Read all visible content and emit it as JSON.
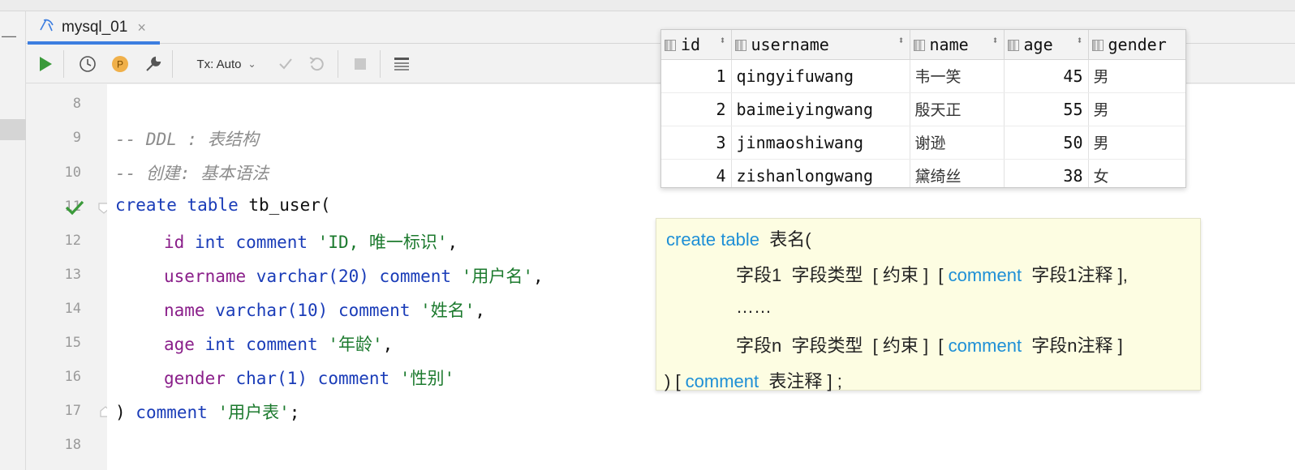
{
  "tab": {
    "label": "mysql_01",
    "close": "×"
  },
  "toolbar": {
    "tx_mode": "Tx: Auto",
    "p_badge": "P"
  },
  "editor": {
    "line_numbers": [
      "8",
      "9",
      "10",
      "11",
      "12",
      "13",
      "14",
      "15",
      "16",
      "17",
      "18"
    ],
    "lines": {
      "l9": "-- DDL : 表结构",
      "l10": "-- 创建: 基本语法",
      "l11_kw": "create table",
      "l11_rest": " tb_user(",
      "l12_a": "id",
      "l12_b": " int ",
      "l12_c": "comment",
      "l12_d": " 'ID, 唯一标识'",
      "l12_e": ",",
      "l13_a": "username",
      "l13_b": " varchar(",
      "l13_n": "20",
      "l13_c": ") ",
      "l13_d": "comment",
      "l13_e": " '用户名'",
      "l13_f": ",",
      "l14_a": "name",
      "l14_b": " varchar(",
      "l14_n": "10",
      "l14_c": ") ",
      "l14_d": "comment",
      "l14_e": " '姓名'",
      "l14_f": ",",
      "l15_a": "age",
      "l15_b": " int ",
      "l15_c": "comment",
      "l15_d": " '年龄'",
      "l15_e": ",",
      "l16_a": "gender",
      "l16_b": " char(",
      "l16_n": "1",
      "l16_c": ") ",
      "l16_d": "comment",
      "l16_e": " '性别'",
      "l17_a": ") ",
      "l17_b": "comment",
      "l17_c": " '用户表'",
      "l17_d": ";"
    }
  },
  "result_grid": {
    "columns": [
      "id",
      "username",
      "name",
      "age",
      "gender"
    ],
    "rows": [
      {
        "id": "1",
        "username": "qingyifuwang",
        "name": "韦一笑",
        "age": "45",
        "gender": "男"
      },
      {
        "id": "2",
        "username": "baimeiyingwang",
        "name": "殷天正",
        "age": "55",
        "gender": "男"
      },
      {
        "id": "3",
        "username": "jinmaoshiwang",
        "name": "谢逊",
        "age": "50",
        "gender": "男"
      },
      {
        "id": "4",
        "username": "zishanlongwang",
        "name": "黛绮丝",
        "age": "38",
        "gender": "女"
      }
    ]
  },
  "syntax_note": {
    "l1_kw": "create table",
    "l1_rest": "  表名(",
    "l2_a": "字段1  字段类型  [ 约束 ]  [ ",
    "l2_kw": "comment",
    "l2_b": "  字段1注释 ],",
    "l3": "……",
    "l4_a": "字段n  字段类型  [ 约束 ]  [ ",
    "l4_kw": "comment",
    "l4_b": "  字段n注释 ]",
    "l5_a": ") [ ",
    "l5_kw": "comment",
    "l5_b": "  表注释 ] ;"
  },
  "colors": {
    "accent": "#3d7ee0",
    "keyword": "#1a3cb8",
    "string": "#1c7a2e",
    "identifier": "#8a1f8a",
    "note_bg": "#fdfde2",
    "note_keyword": "#1e8fd6",
    "run_green": "#3a9a3a"
  }
}
